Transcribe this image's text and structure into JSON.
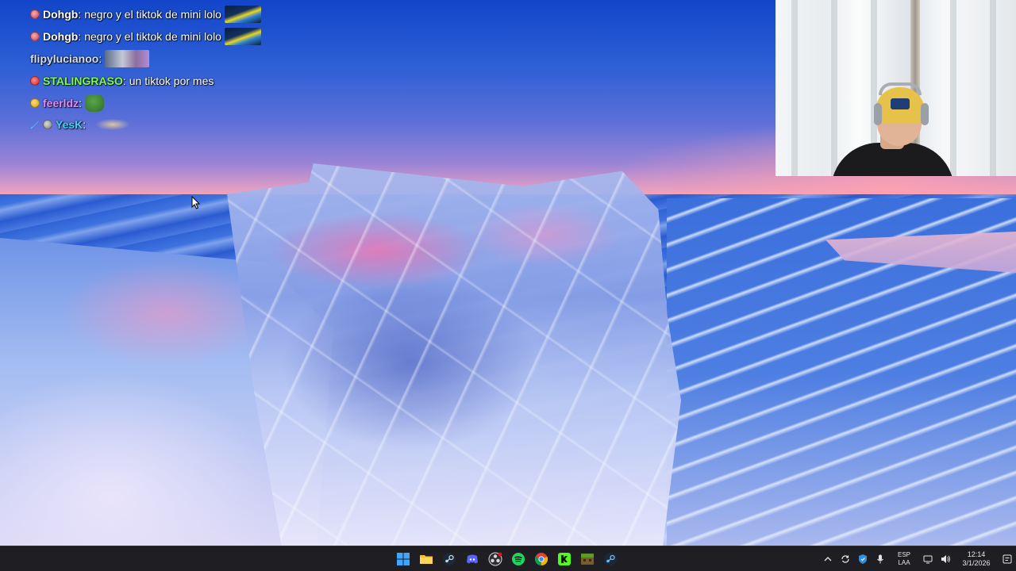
{
  "chat": {
    "messages": [
      {
        "user": "Dohgb",
        "sep": ":",
        "text": "negro y el tiktok de mini lolo",
        "user_color": "#ffffff",
        "badge": "badge-icon",
        "emote": "car-emote"
      },
      {
        "user": "Dohgb",
        "sep": ":",
        "text": "negro y el tiktok de mini lolo",
        "user_color": "#ffffff",
        "badge": "badge-icon",
        "emote": "car-emote"
      },
      {
        "user": "flipylucianoo",
        "sep": ":",
        "text": "",
        "user_color": "#d3def2",
        "emote": "photo-emote"
      },
      {
        "user": "STALINGRASO",
        "sep": ":",
        "text": "un tiktok por mes",
        "user_color": "#7cff4a",
        "badge": "badge-icon"
      },
      {
        "user": "feerldz",
        "sep": ":",
        "text": "",
        "user_color": "#e18cff",
        "badge": "badge-icon",
        "emote": "pepe-emote"
      },
      {
        "user": "YesK",
        "sep": ":",
        "text": "",
        "user_color": "#3fd2ff",
        "badge": "sword-icon",
        "emote": "bread-emote"
      }
    ]
  },
  "taskbar": {
    "apps": [
      {
        "name": "start-button",
        "icon": "windows-icon"
      },
      {
        "name": "file-explorer",
        "icon": "folder-icon"
      },
      {
        "name": "steam",
        "icon": "steam-icon"
      },
      {
        "name": "discord",
        "icon": "discord-icon"
      },
      {
        "name": "obs",
        "icon": "obs-icon"
      },
      {
        "name": "spotify",
        "icon": "spotify-icon"
      },
      {
        "name": "chrome",
        "icon": "chrome-icon"
      },
      {
        "name": "kick",
        "icon": "kick-icon"
      },
      {
        "name": "minecraft",
        "icon": "minecraft-icon"
      },
      {
        "name": "steam-2",
        "icon": "steam-icon"
      }
    ],
    "tray": {
      "language_line1": "ESP",
      "language_line2": "LAA",
      "time": "12:14",
      "date": "3/1/2026"
    }
  },
  "colors": {
    "taskbar_bg": "#1f1f23",
    "accent_windows": "#3ea6ff",
    "spotify": "#1ed760",
    "kick": "#53fc18"
  }
}
